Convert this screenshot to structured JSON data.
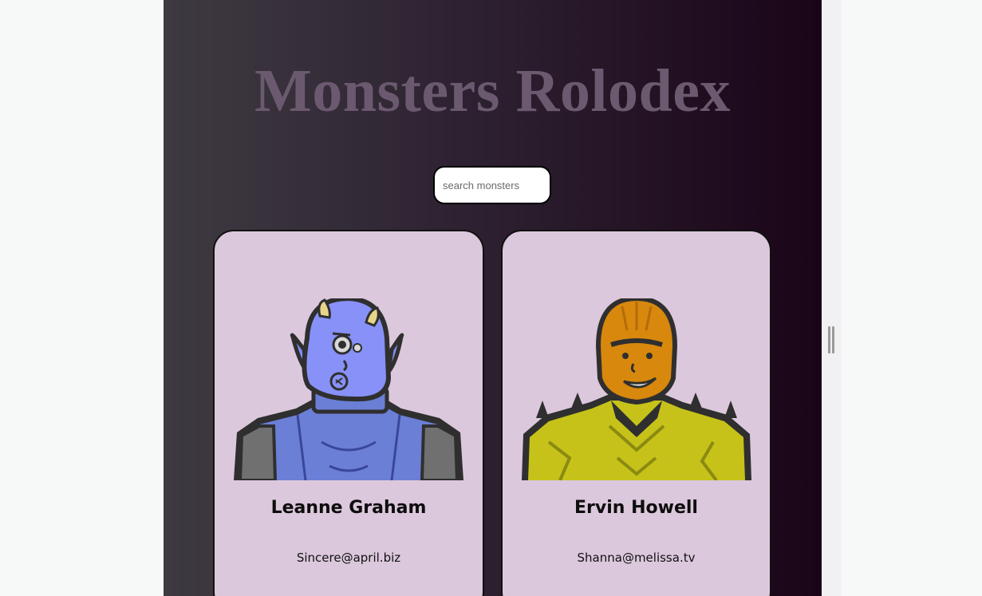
{
  "app": {
    "title": "Monsters Rolodex",
    "search": {
      "placeholder": "search monsters",
      "value": ""
    }
  },
  "monsters": [
    {
      "name": "Leanne Graham",
      "email": "Sincere@april.biz",
      "avatar_icon": "blue-horned-monster-icon",
      "color": "#7f8cf0"
    },
    {
      "name": "Ervin Howell",
      "email": "Shanna@melissa.tv",
      "avatar_icon": "yellow-armored-monster-icon",
      "color": "#d98b0f"
    }
  ]
}
